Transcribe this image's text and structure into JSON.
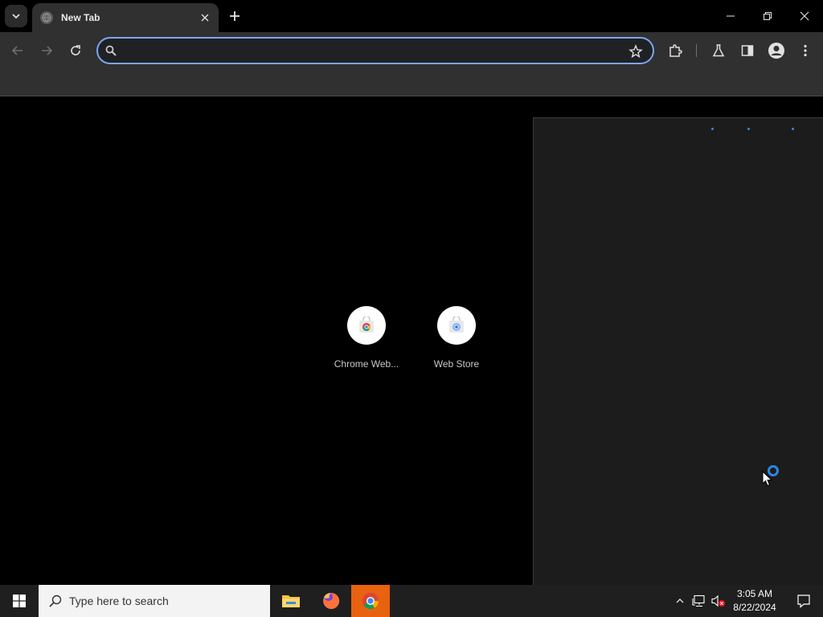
{
  "browser": {
    "tab": {
      "title": "New Tab"
    },
    "omnibox": {
      "value": "",
      "placeholder": ""
    }
  },
  "content": {
    "shortcuts": [
      {
        "label": "Chrome Web..."
      },
      {
        "label": "Web Store"
      }
    ]
  },
  "taskbar": {
    "search_placeholder": "Type here to search",
    "clock": {
      "time": "3:05 AM",
      "date": "8/22/2024"
    }
  },
  "colors": {
    "omnibox_focus_ring": "#7aa7f5",
    "spinner": "#2c86e8",
    "active_taskbar_app": "#e8620f"
  }
}
